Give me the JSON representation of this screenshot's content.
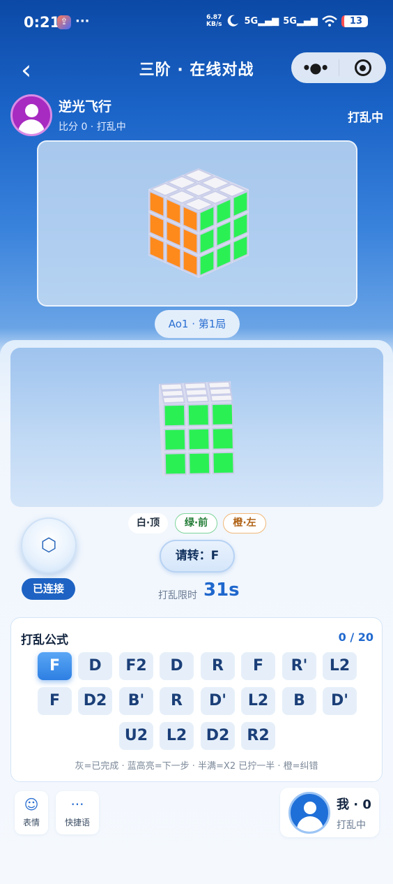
{
  "status_bar": {
    "time": "0:21",
    "app_badge": "⇪",
    "more": "···",
    "speed_value": "6.87",
    "speed_unit": "KB/s",
    "signal1": "5G",
    "signal2": "5G",
    "battery": "13"
  },
  "nav": {
    "back": "‹",
    "title": "三阶 · 在线对战",
    "more": "•●•"
  },
  "opponent": {
    "name": "逆光飞行",
    "subtitle": "比分 0 · 打乱中",
    "status": "打乱中"
  },
  "round_chip": "Ao1 · 第1局",
  "ble_icon": "⬡",
  "connection": "已连接",
  "orientation": {
    "top": "白·顶",
    "front": "绿·前",
    "left": "橙·左"
  },
  "turn_prompt": "请转：F",
  "time_limit": {
    "label": "打乱限时",
    "value": "31s"
  },
  "scramble": {
    "title": "打乱公式",
    "progress": "0 / 20",
    "rows": [
      [
        "F",
        "D",
        "F2",
        "D",
        "R",
        "F",
        "R'",
        "L2"
      ],
      [
        "F",
        "D2",
        "B'",
        "R",
        "D'",
        "L2",
        "B",
        "D'"
      ],
      [
        "U2",
        "L2",
        "D2",
        "R2"
      ]
    ],
    "legend": "灰=已完成 · 蓝高亮=下一步 · 半满=X2 已拧一半 · 橙=纠错"
  },
  "toolbar": {
    "emoji_icon": "☺",
    "emoji_label": "表情",
    "phrase_icon": "···",
    "phrase_label": "快捷语"
  },
  "me": {
    "name": "我 · 0",
    "status": "打乱中"
  },
  "colors": {
    "accent": "#1f67cd",
    "cube_green": "#2bf054",
    "cube_orange": "#ff8a1c",
    "cube_white": "#f4f4f8"
  }
}
